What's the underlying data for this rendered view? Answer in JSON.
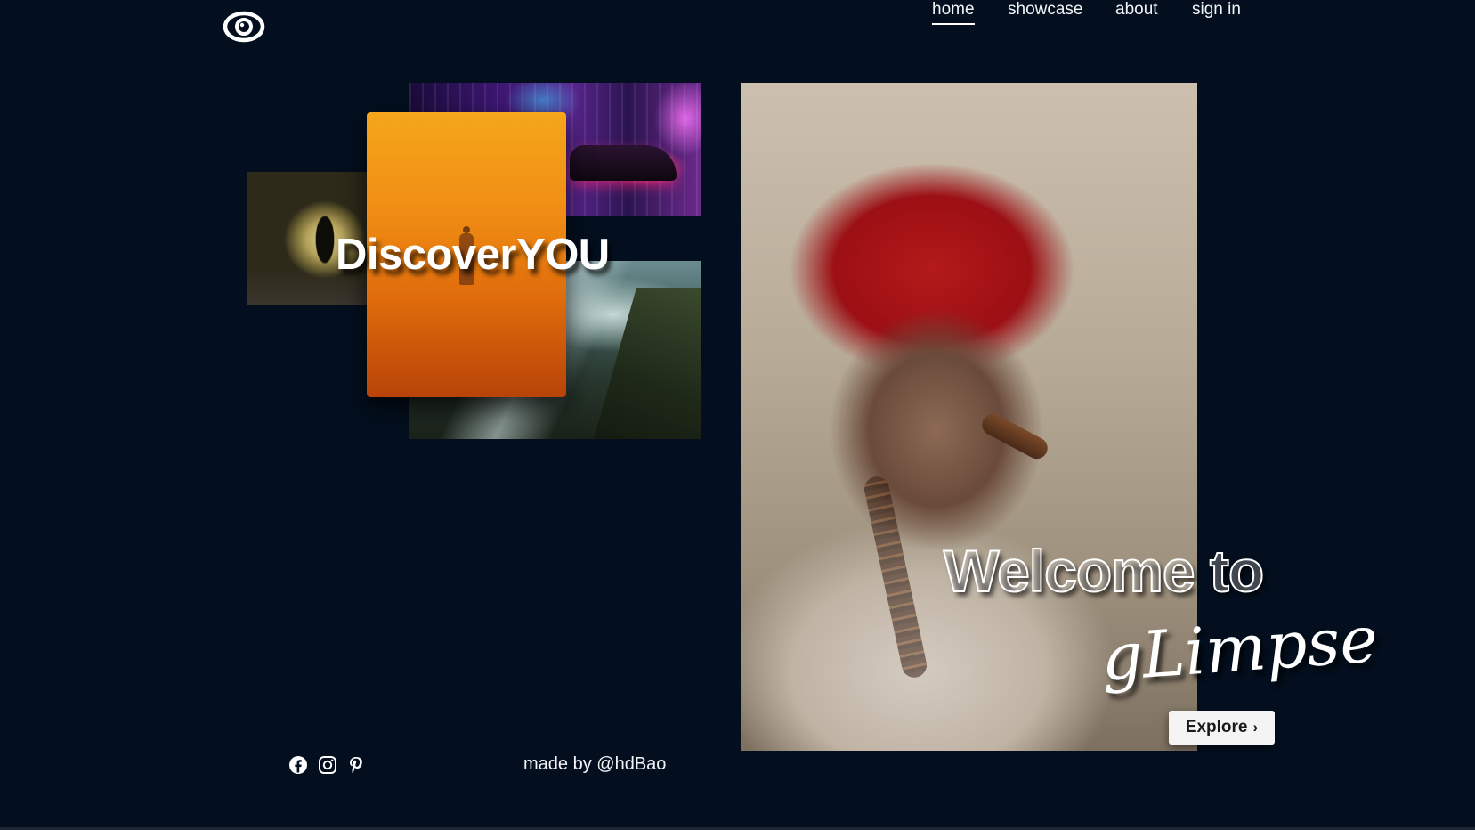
{
  "nav": {
    "logo_icon": "eye-icon",
    "items": [
      {
        "label": "home",
        "active": true
      },
      {
        "label": "showcase",
        "active": false
      },
      {
        "label": "about",
        "active": false
      },
      {
        "label": "sign in",
        "active": false
      }
    ]
  },
  "collage": {
    "headline": "DiscoverYOU"
  },
  "hero": {
    "welcome_line": "Welcome to",
    "brand_script": "gLimpse",
    "explore_label": "Explore",
    "explore_icon": "chevron-right-icon"
  },
  "footer": {
    "social_icons": [
      "facebook-icon",
      "instagram-icon",
      "pinterest-icon"
    ],
    "credit": "made by @hdBao"
  },
  "colors": {
    "background": "#030f1f",
    "text": "#ffffff",
    "button_bg": "#f4f4f4"
  }
}
